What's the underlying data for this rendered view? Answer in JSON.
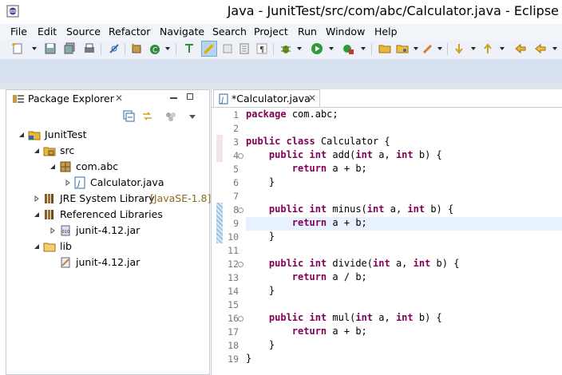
{
  "window": {
    "title": "Java - JunitTest/src/com/abc/Calculator.java - Eclipse"
  },
  "menu": [
    "File",
    "Edit",
    "Source",
    "Refactor",
    "Navigate",
    "Search",
    "Project",
    "Run",
    "Window",
    "Help"
  ],
  "package_explorer": {
    "title": "Package Explorer",
    "close_glyph": "✕",
    "tree": [
      {
        "label": "JunitTest",
        "decoration": "",
        "icon": "project-icon"
      },
      {
        "label": "src",
        "decoration": "",
        "icon": "source-folder-icon"
      },
      {
        "label": "com.abc",
        "decoration": "",
        "icon": "package-icon"
      },
      {
        "label": "Calculator.java",
        "decoration": "",
        "icon": "java-file-icon"
      },
      {
        "label": "JRE System Library",
        "decoration": "[JavaSE-1.8]",
        "icon": "library-icon"
      },
      {
        "label": "Referenced Libraries",
        "decoration": "",
        "icon": "library-icon"
      },
      {
        "label": "junit-4.12.jar",
        "decoration": "",
        "icon": "jar-icon"
      },
      {
        "label": "lib",
        "decoration": "",
        "icon": "folder-icon"
      },
      {
        "label": "junit-4.12.jar",
        "decoration": "",
        "icon": "jar-file-icon"
      }
    ]
  },
  "editor": {
    "tab_label": "*Calculator.java",
    "close_glyph": "✕",
    "line_numbers": [
      "1",
      "2",
      "3",
      "4",
      "5",
      "6",
      "7",
      "8",
      "9",
      "10",
      "11",
      "12",
      "13",
      "14",
      "15",
      "16",
      "17",
      "18",
      "19"
    ],
    "lines": [
      "package com.abc;",
      "",
      "public class Calculator {",
      "    public int add(int a, int b) {",
      "        return a + b;",
      "    }",
      "",
      "    public int minus(int a, int b) {",
      "        return a + b;",
      "    }",
      "",
      "    public int divide(int a, int b) {",
      "        return a / b;",
      "    }",
      "",
      "    public int mul(int a, int b) {",
      "        return a + b;",
      "    }",
      "}"
    ],
    "keyword_color": "#7f0055",
    "current_line": 9
  }
}
